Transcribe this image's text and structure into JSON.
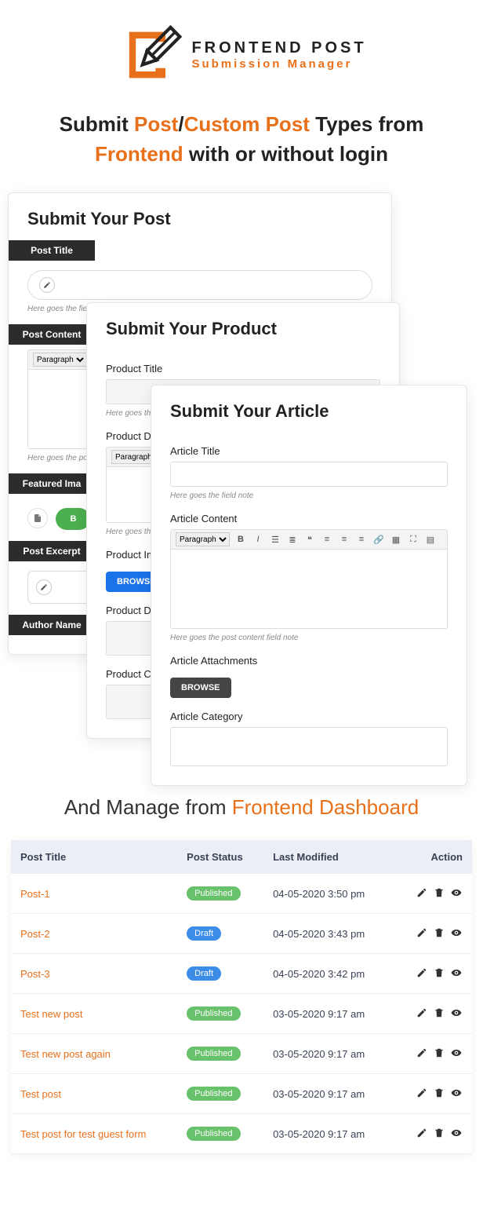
{
  "logo": {
    "line1": "FRONTEND POST",
    "line2": "Submission Manager"
  },
  "tagline": {
    "p1": "Submit ",
    "accent1": "Post",
    "sep": "/",
    "accent2": "Custom Post",
    "p2": " Types from ",
    "accent3": "Frontend",
    "p3": " with or without login"
  },
  "card_post": {
    "title": "Submit Your Post",
    "labels": {
      "title": "Post Title",
      "content": "Post Content",
      "featured": "Featured Ima",
      "excerpt": "Post Excerpt",
      "author": "Author Name"
    },
    "note_title": "Here goes the fie",
    "paragraph": "Paragraph",
    "note_content": "Here goes the po",
    "button_upload": "B"
  },
  "card_product": {
    "title": "Submit Your Product",
    "labels": {
      "title": "Product Title",
      "detail": "Product Deta",
      "image": "Product Imag",
      "detail2": "Product Deta",
      "category": "Product Cate"
    },
    "note_title": "Here goes the field",
    "paragraph": "Paragraph",
    "note_content": "Here goes the po",
    "button_browse": "BROWSE"
  },
  "card_article": {
    "title": "Submit Your Article",
    "labels": {
      "title": "Article Title",
      "content": "Article Content",
      "attachments": "Article Attachments",
      "category": "Article Category"
    },
    "note_title": "Here goes the field note",
    "paragraph": "Paragraph",
    "note_content": "Here goes the post content field note",
    "button_browse": "BROWSE"
  },
  "tagline2": {
    "p1": "And Manage from ",
    "accent1": "Frontend Dashboard"
  },
  "dashboard": {
    "headers": {
      "title": "Post Title",
      "status": "Post Status",
      "modified": "Last Modified",
      "action": "Action"
    },
    "rows": [
      {
        "title": "Post-1",
        "status": "Published",
        "status_type": "pub",
        "modified": "04-05-2020 3:50 pm"
      },
      {
        "title": "Post-2",
        "status": "Draft",
        "status_type": "draft",
        "modified": "04-05-2020 3:43 pm"
      },
      {
        "title": "Post-3",
        "status": "Draft",
        "status_type": "draft",
        "modified": "04-05-2020 3:42 pm"
      },
      {
        "title": "Test new post",
        "status": "Published",
        "status_type": "pub",
        "modified": "03-05-2020 9:17 am"
      },
      {
        "title": "Test new post again",
        "status": "Published",
        "status_type": "pub",
        "modified": "03-05-2020 9:17 am"
      },
      {
        "title": "Test post",
        "status": "Published",
        "status_type": "pub",
        "modified": "03-05-2020 9:17 am"
      },
      {
        "title": "Test post for test guest form",
        "status": "Published",
        "status_type": "pub",
        "modified": "03-05-2020 9:17 am"
      }
    ]
  }
}
